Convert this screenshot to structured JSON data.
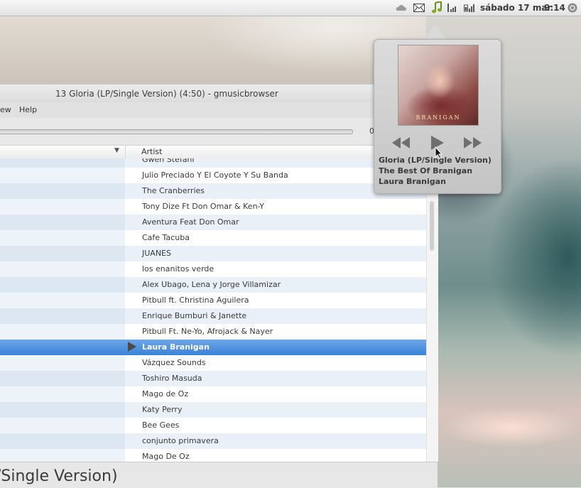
{
  "panel": {
    "date": "sábado 17 mar",
    "time": "9:14",
    "icons": [
      "cloud-icon",
      "mail-icon",
      "music-note-icon",
      "signal-icon",
      "battery-signal-icon",
      "power-icon"
    ]
  },
  "window": {
    "title": "13 Gloria (LP/Single Version) (4:50) - gmusicbrowser",
    "menu": [
      "ew",
      "Help"
    ],
    "time_partial": "0"
  },
  "list": {
    "column_artist": "Artist",
    "rows": [
      {
        "artist": "Gwen Stefani"
      },
      {
        "artist": "Julio Preciado Y El Coyote Y Su Banda"
      },
      {
        "artist": "The Cranberries"
      },
      {
        "artist": "Tony Dize Ft Don Omar & Ken-Y"
      },
      {
        "artist": "Aventura Feat Don Omar"
      },
      {
        "artist": "Cafe Tacuba"
      },
      {
        "artist": "JUANES"
      },
      {
        "artist": "los enanitos verde"
      },
      {
        "artist": "Alex Ubago, Lena y Jorge Villamizar"
      },
      {
        "artist": "Pitbull ft. Christina Aguilera"
      },
      {
        "artist": "Enrique Bumburi & Janette"
      },
      {
        "artist": "Pitbull Ft. Ne-Yo, Afrojack & Nayer"
      },
      {
        "artist": "Laura Branigan",
        "selected": true,
        "playing": true
      },
      {
        "artist": "Vázquez Sounds"
      },
      {
        "artist": "Toshiro Masuda"
      },
      {
        "artist": "Mago de Oz"
      },
      {
        "artist": "Katy Perry"
      },
      {
        "artist": "Bee Gees"
      },
      {
        "artist": "conjunto primavera"
      },
      {
        "artist": "Mago De Oz"
      }
    ]
  },
  "status": {
    "big_title": "/Single Version)"
  },
  "popup": {
    "album_logo_text": "BRANIGAN",
    "title": "Gloria (LP/Single Version)",
    "album": "The Best Of Branigan",
    "artist": "Laura Branigan"
  }
}
